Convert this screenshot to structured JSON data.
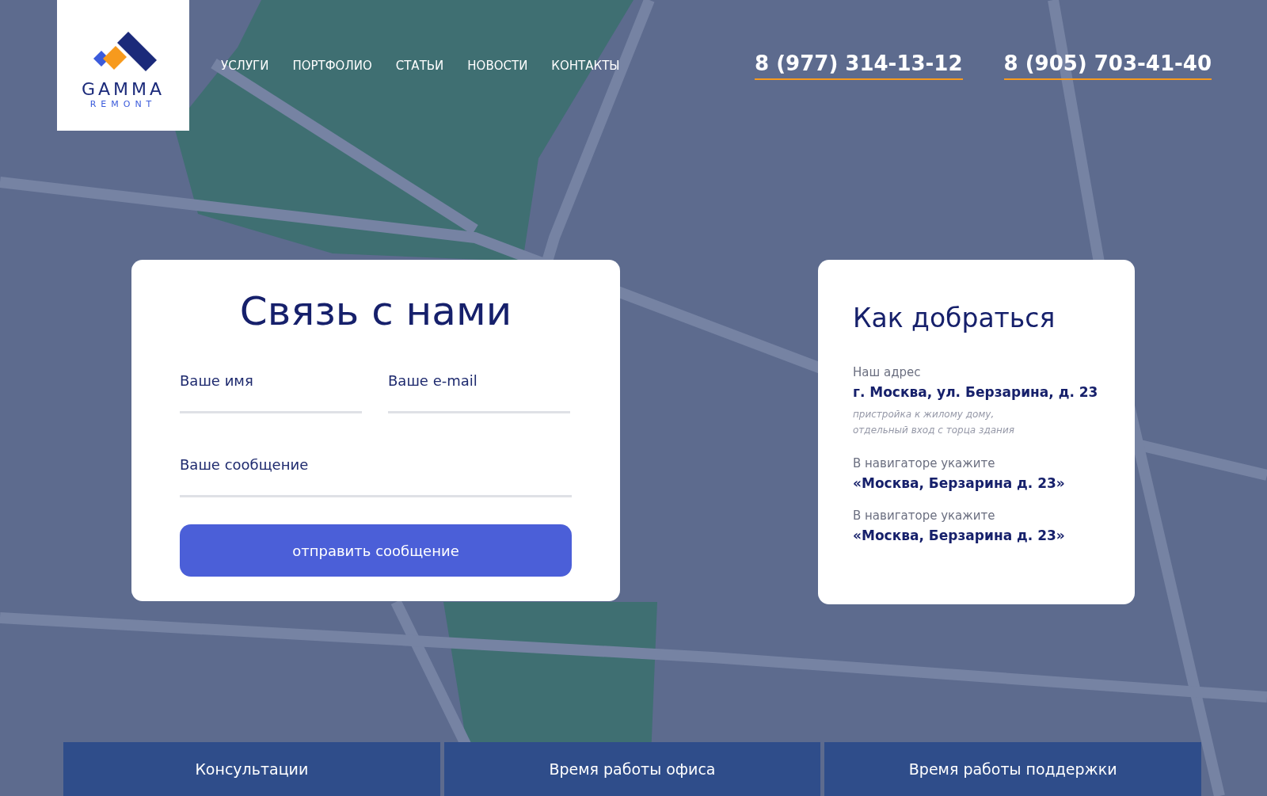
{
  "logo": {
    "name": "GAMMA",
    "subtitle": "REMONT"
  },
  "nav": [
    "УСЛУГИ",
    "ПОРТФОЛИО",
    "СТАТЬИ",
    "НОВОСТИ",
    "КОНТАКТЫ"
  ],
  "phones": [
    "8 (977) 314-13-12",
    "8 (905) 703-41-40"
  ],
  "contact_form": {
    "title": "Связь с нами",
    "fields": [
      {
        "placeholder": "Ваше имя",
        "wide": false
      },
      {
        "placeholder": "Ваше e-mail",
        "wide": false
      },
      {
        "placeholder": "Ваше сообщение",
        "wide": true
      }
    ],
    "submit": "отправить сообщение"
  },
  "directions": {
    "title": "Как добраться",
    "blocks": [
      {
        "label": "Наш адрес",
        "value": "г. Москва, ул. Берзарина, д. 23",
        "note": "пристройка к жилому дому,\nотдельный вход с торца здания"
      },
      {
        "label": "В навигаторе укажите",
        "value": "«Москва, Берзарина д. 23»"
      },
      {
        "label": "В навигаторе укажите",
        "value": "«Москва, Берзарина д. 23»"
      }
    ]
  },
  "bottom_tabs": [
    "Консультации",
    "Время работы офиса",
    "Время работы поддержки"
  ]
}
